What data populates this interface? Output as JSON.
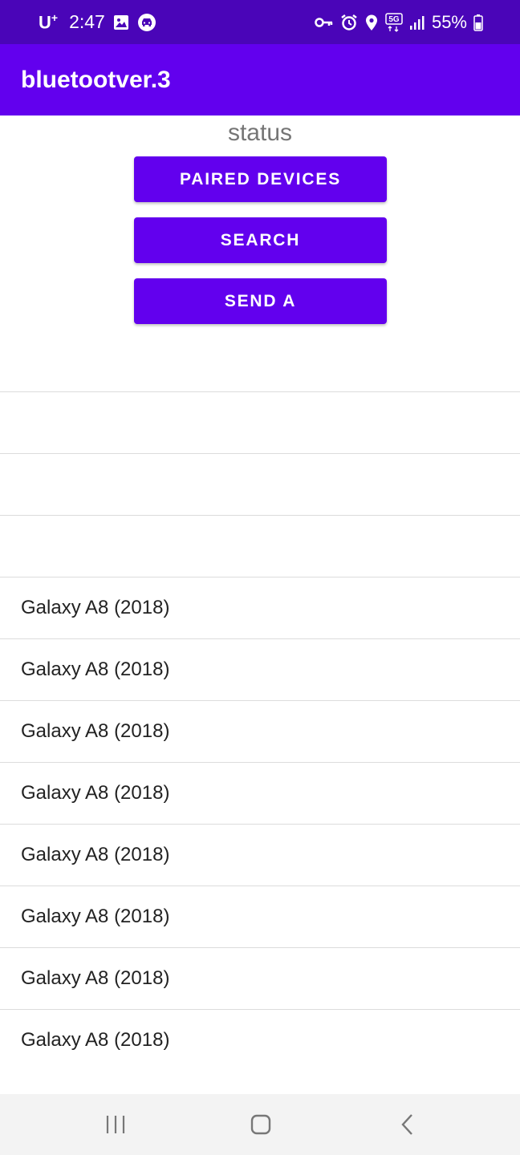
{
  "statusbar": {
    "carrier": "U",
    "carrier_sup": "+",
    "time": "2:47",
    "network_label": "5G",
    "battery": "55%",
    "icons_left": [
      "gallery-icon",
      "car-mode-icon"
    ],
    "icons_right": [
      "vpn-key-icon",
      "alarm-icon",
      "location-icon",
      "5g-icon",
      "signal-icon",
      "battery-icon"
    ]
  },
  "appbar": {
    "title": "bluetootver.3"
  },
  "main": {
    "status": "status",
    "buttons": {
      "paired": "PAIRED DEVICES",
      "search": "SEARCH",
      "send": "SEND A"
    },
    "list": [
      "",
      "",
      "",
      "Galaxy A8 (2018)",
      "Galaxy A8 (2018)",
      "Galaxy A8 (2018)",
      "Galaxy A8 (2018)",
      "Galaxy A8 (2018)",
      "Galaxy A8 (2018)",
      "Galaxy A8 (2018)",
      "Galaxy A8 (2018)"
    ]
  },
  "navbar": {
    "icons": [
      "recent-apps-icon",
      "home-icon",
      "back-icon"
    ]
  },
  "colors": {
    "statusbar": "#4a05b8",
    "accent": "#6200ee",
    "divider": "#dcdcdc",
    "navbar": "#f3f3f3"
  }
}
